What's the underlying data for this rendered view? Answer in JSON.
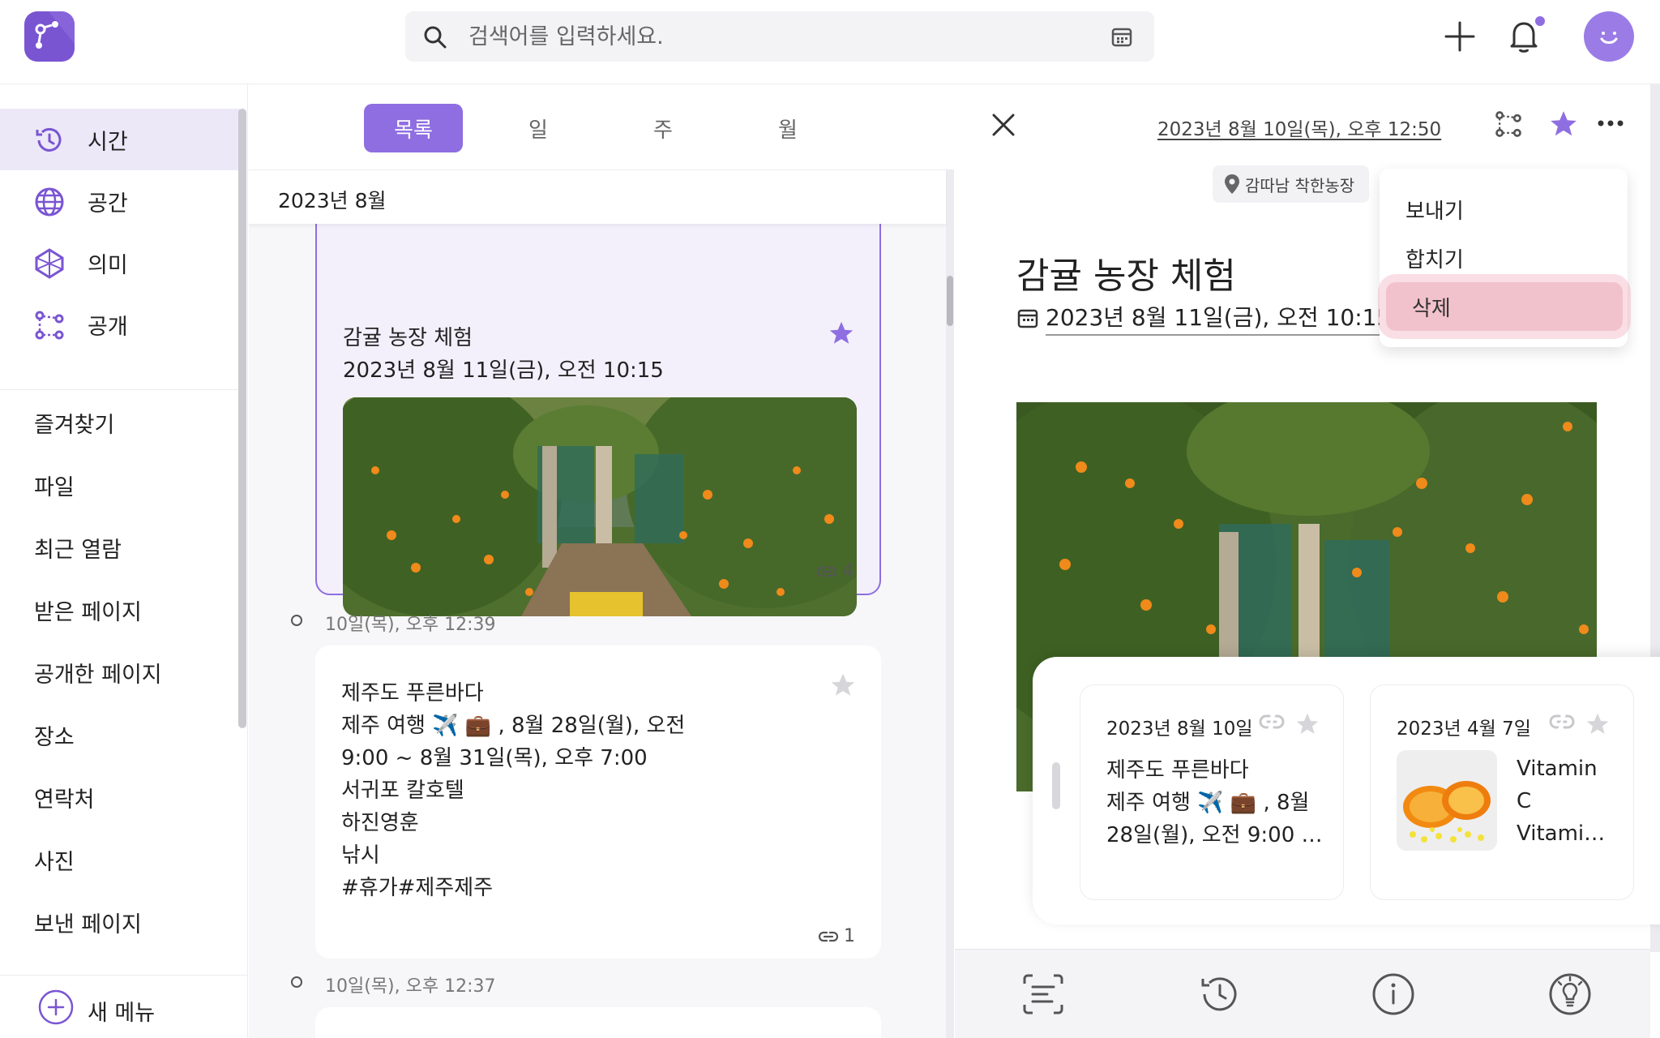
{
  "search": {
    "placeholder": "검색어를 입력하세요."
  },
  "sidebar": {
    "nav": [
      {
        "label": "시간",
        "icon": "clock-history-icon"
      },
      {
        "label": "공간",
        "icon": "globe-icon"
      },
      {
        "label": "의미",
        "icon": "network-icon"
      },
      {
        "label": "공개",
        "icon": "share-nodes-icon"
      }
    ],
    "links": [
      "즐겨찾기",
      "파일",
      "최근 열람",
      "받은 페이지",
      "공개한 페이지",
      "장소",
      "연락처",
      "사진",
      "보낸 페이지"
    ],
    "new_menu": "새 메뉴"
  },
  "tabs": [
    "목록",
    "일",
    "주",
    "월"
  ],
  "month_header": "2023년 8월",
  "cards": [
    {
      "title": "감귤 농장 체험",
      "date": "2023년 8월 11일(금), 오전 10:15",
      "link_count": "4",
      "starred": true
    },
    {
      "time": "10일(목), 오후 12:39",
      "lines": [
        "제주도 푸른바다",
        "제주 여행 ✈️ 💼 , 8월 28일(월), 오전",
        "9:00 ~ 8월 31일(목), 오후 7:00",
        "서귀포 칼호텔",
        "하진영훈",
        "낚시",
        "#휴가#제주제주"
      ],
      "link_count": "1",
      "starred": false
    },
    {
      "time": "10일(목), 오후 12:37"
    }
  ],
  "detail": {
    "date": "2023년 8월 10일(목), 오후 12:50",
    "location": "감따남 착한농장",
    "title": "감귤 농장 체험",
    "when": "2023년 8월 11일(금), 오전 10:15",
    "menu": [
      "보내기",
      "합치기",
      "삭제"
    ],
    "related": [
      {
        "date": "2023년 8월 10일",
        "lines": [
          "제주도 푸른바다",
          "제주 여행 ✈️ 💼 , 8월",
          "28일(월), 오전 9:00 …"
        ]
      },
      {
        "date": "2023년 4월 7일",
        "lines": [
          "Vitamin",
          "C",
          "Vitami…"
        ]
      }
    ]
  },
  "colors": {
    "accent": "#8e6ee0",
    "highlight": "#f2c2cc"
  }
}
